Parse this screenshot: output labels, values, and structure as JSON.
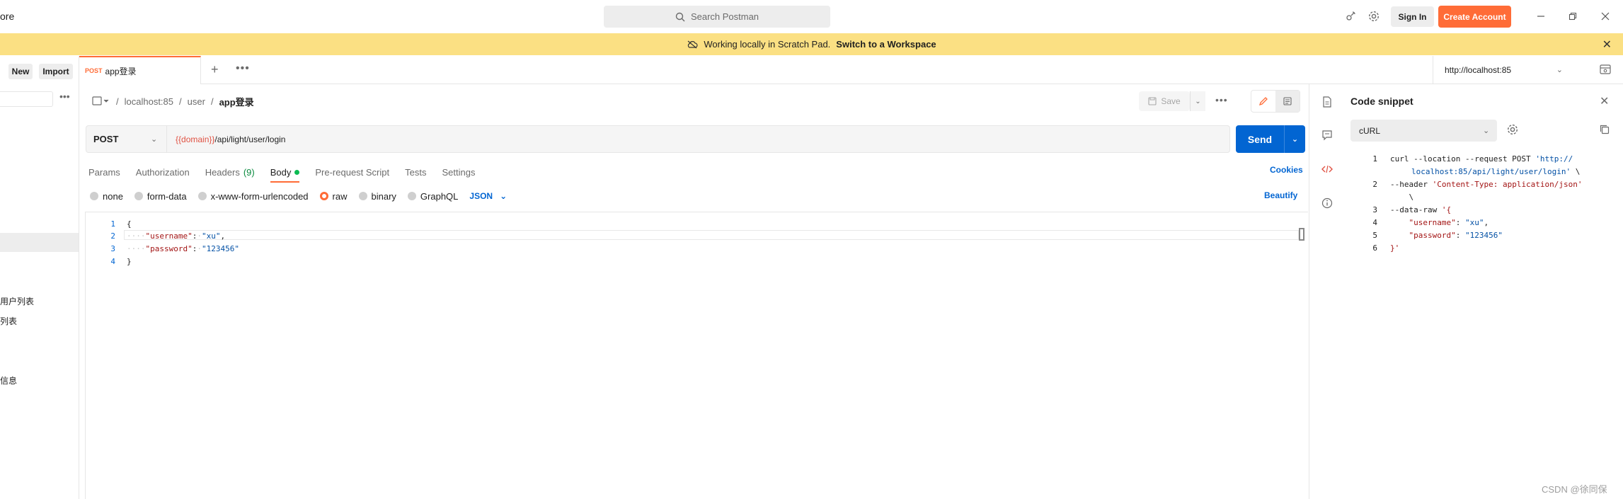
{
  "titlebar": {
    "left_text": "ore",
    "search_placeholder": "Search Postman",
    "signin_label": "Sign In",
    "create_account_label": "Create Account"
  },
  "banner": {
    "text": "Working locally in Scratch Pad.",
    "link": "Switch to a Workspace"
  },
  "sidebar": {
    "new_label": "New",
    "import_label": "Import",
    "items": [
      "用户列表",
      "列表",
      "信息"
    ]
  },
  "tabs": {
    "active_method": "POST",
    "active_name": "app登录",
    "environment": "http://localhost:85"
  },
  "request": {
    "breadcrumb": [
      "localhost:85",
      "user",
      "app登录"
    ],
    "save_label": "Save",
    "method": "POST",
    "url_var": "{{domain}}",
    "url_path": "/api/light/user/login",
    "send_label": "Send",
    "tabs": [
      {
        "label": "Params"
      },
      {
        "label": "Authorization"
      },
      {
        "label": "Headers",
        "count": "(9)"
      },
      {
        "label": "Body"
      },
      {
        "label": "Pre-request Script"
      },
      {
        "label": "Tests"
      },
      {
        "label": "Settings"
      }
    ],
    "cookies_label": "Cookies",
    "body_types": [
      "none",
      "form-data",
      "x-www-form-urlencoded",
      "raw",
      "binary",
      "GraphQL"
    ],
    "selected_body_type": "raw",
    "format": "JSON",
    "beautify_label": "Beautify",
    "body_lines": [
      {
        "n": "1",
        "text": "{"
      },
      {
        "n": "2",
        "key": "\"username\"",
        "val": "\"xu\"",
        "trail": ","
      },
      {
        "n": "3",
        "key": "\"password\"",
        "val": "\"123456\"",
        "trail": ""
      },
      {
        "n": "4",
        "text": "}"
      }
    ]
  },
  "snippet": {
    "title": "Code snippet",
    "language": "cURL",
    "lines": [
      {
        "n": "1",
        "a": "curl --location --request POST ",
        "s": "'http://"
      },
      {
        "n": "",
        "a": "",
        "s": "localhost:85/api/light/user/login'",
        "b": " \\"
      },
      {
        "n": "2",
        "a": "--header ",
        "s": "'Content-Type: application/json'"
      },
      {
        "n": "",
        "a": "    \\",
        "s": ""
      },
      {
        "n": "3",
        "a": "--data-raw ",
        "s": "'{"
      },
      {
        "n": "4",
        "a": "    ",
        "s": "\"username\"",
        "b": ": ",
        "s2": "\"xu\"",
        "c": ","
      },
      {
        "n": "5",
        "a": "    ",
        "s": "\"password\"",
        "b": ": ",
        "s2": "\"123456\""
      },
      {
        "n": "6",
        "a": "",
        "s": "}'"
      }
    ]
  },
  "watermark": "CSDN @徐同保",
  "colors": {
    "accent": "#ff6c37",
    "primary": "#0265d2",
    "banner": "#fbe083"
  }
}
